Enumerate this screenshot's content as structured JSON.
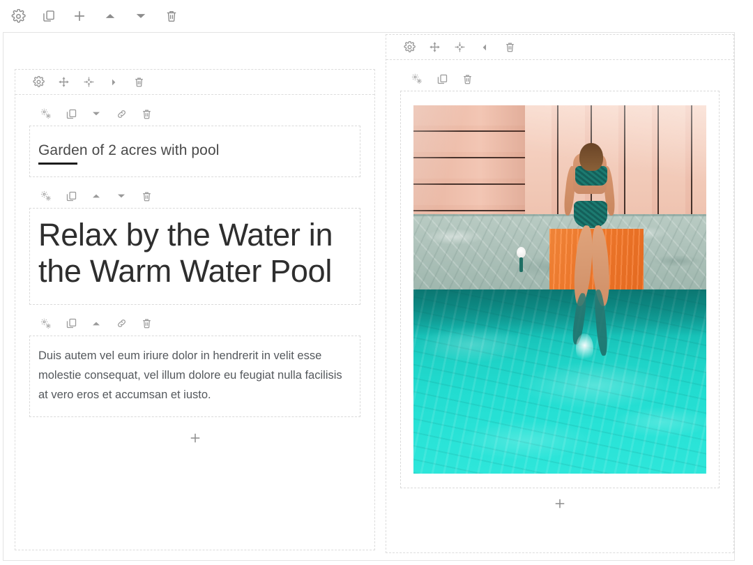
{
  "editor": {
    "global_toolbar": {
      "name": "page-toolbar",
      "buttons": [
        {
          "id": "settings",
          "icon": "gear-icon",
          "label": "Settings"
        },
        {
          "id": "duplicate",
          "icon": "duplicate-icon",
          "label": "Duplicate"
        },
        {
          "id": "add",
          "icon": "plus-icon",
          "label": "Add"
        },
        {
          "id": "move-up",
          "icon": "triangle-up-icon",
          "label": "Move up"
        },
        {
          "id": "move-down",
          "icon": "triangle-down-icon",
          "label": "Move down"
        },
        {
          "id": "delete",
          "icon": "trash-icon",
          "label": "Delete"
        }
      ]
    },
    "left_column": {
      "name": "left-column",
      "toolbar": {
        "buttons": [
          {
            "id": "settings",
            "icon": "gear-icon",
            "label": "Settings"
          },
          {
            "id": "move",
            "icon": "move-arrows-icon",
            "label": "Move"
          },
          {
            "id": "resize",
            "icon": "collapse-arrows-icon",
            "label": "Resize"
          },
          {
            "id": "next",
            "icon": "triangle-right-icon",
            "label": "Next"
          },
          {
            "id": "delete",
            "icon": "trash-icon",
            "label": "Delete"
          }
        ]
      },
      "elements": [
        {
          "id": "subtitle-field",
          "type": "text-field",
          "toolbar": [
            {
              "id": "settings",
              "icon": "cogs-icon",
              "label": "Element settings"
            },
            {
              "id": "duplicate",
              "icon": "duplicate-icon",
              "label": "Duplicate"
            },
            {
              "id": "move-down",
              "icon": "triangle-down-icon",
              "label": "Move down"
            },
            {
              "id": "link",
              "icon": "link-icon",
              "label": "Link"
            },
            {
              "id": "delete",
              "icon": "trash-icon",
              "label": "Delete"
            }
          ],
          "value": "Garden of 2 acres with pool"
        },
        {
          "id": "heading-element",
          "type": "heading",
          "toolbar": [
            {
              "id": "settings",
              "icon": "cogs-icon",
              "label": "Element settings"
            },
            {
              "id": "duplicate",
              "icon": "duplicate-icon",
              "label": "Duplicate"
            },
            {
              "id": "move-up",
              "icon": "triangle-up-icon",
              "label": "Move up"
            },
            {
              "id": "move-down",
              "icon": "triangle-down-icon",
              "label": "Move down"
            },
            {
              "id": "delete",
              "icon": "trash-icon",
              "label": "Delete"
            }
          ],
          "value": "Relax by the Water in the Warm Water Pool"
        },
        {
          "id": "paragraph-element",
          "type": "paragraph",
          "toolbar": [
            {
              "id": "settings",
              "icon": "cogs-icon",
              "label": "Element settings"
            },
            {
              "id": "duplicate",
              "icon": "duplicate-icon",
              "label": "Duplicate"
            },
            {
              "id": "move-up",
              "icon": "triangle-up-icon",
              "label": "Move up"
            },
            {
              "id": "link",
              "icon": "link-icon",
              "label": "Link"
            },
            {
              "id": "delete",
              "icon": "trash-icon",
              "label": "Delete"
            }
          ],
          "value": "Duis autem vel eum iriure dolor in hendrerit in velit esse molestie consequat, vel illum dolore eu feugiat nulla facilisis at vero eros et accumsan et iusto."
        }
      ],
      "add_button": {
        "icon": "plus-icon",
        "label": "Add element"
      }
    },
    "right_column": {
      "name": "right-column",
      "toolbar": {
        "buttons": [
          {
            "id": "settings",
            "icon": "gear-icon",
            "label": "Settings"
          },
          {
            "id": "move",
            "icon": "move-arrows-icon",
            "label": "Move"
          },
          {
            "id": "resize",
            "icon": "collapse-arrows-icon",
            "label": "Resize"
          },
          {
            "id": "prev",
            "icon": "triangle-left-icon",
            "label": "Previous"
          },
          {
            "id": "delete",
            "icon": "trash-icon",
            "label": "Delete"
          }
        ]
      },
      "elements": [
        {
          "id": "image-element",
          "type": "image",
          "toolbar": [
            {
              "id": "settings",
              "icon": "cogs-icon",
              "label": "Element settings"
            },
            {
              "id": "duplicate",
              "icon": "duplicate-icon",
              "label": "Duplicate"
            },
            {
              "id": "delete",
              "icon": "trash-icon",
              "label": "Delete"
            }
          ],
          "alt": "Aerial view of a woman in a teal swimsuit sitting on an orange towel at the edge of a turquoise pool beside a pink wooden deck"
        }
      ],
      "add_button": {
        "icon": "plus-icon",
        "label": "Add element"
      }
    }
  },
  "colors": {
    "icon_gray": "#8c8c8c",
    "border_dashed": "#dcdcdc",
    "canvas_border": "#e3e3e3",
    "heading_text": "#2e2e2e",
    "body_text": "#54585c",
    "field_text": "#4a4a4a",
    "field_underline": "#1b1b1b",
    "water_deep": "#0f8f88",
    "water_bright": "#2ee6da",
    "deck_pink": "#f2c3b0",
    "towel_orange": "#f87c2c",
    "concrete_gray": "#aec2ba",
    "swimsuit_teal": "#14605a"
  }
}
